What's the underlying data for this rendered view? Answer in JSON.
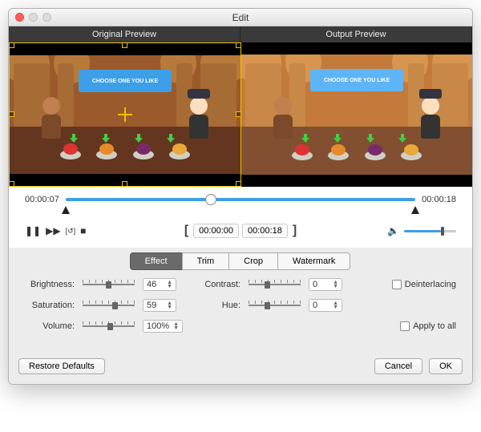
{
  "window": {
    "title": "Edit"
  },
  "preview": {
    "original_label": "Original Preview",
    "output_label": "Output Preview",
    "banner_text": "CHOOSE ONE YOU LIKE"
  },
  "timeline": {
    "current": "00:00:07",
    "end": "00:00:18"
  },
  "playback": {
    "pause_glyph": "❚❚",
    "next_glyph": "▶▶",
    "loop_glyph": "[↺]",
    "stop_glyph": "■"
  },
  "range": {
    "open": "[",
    "start": "00:00:00",
    "end": "00:00:18",
    "close": "]"
  },
  "volume": {
    "icon": "🔉"
  },
  "tabs": {
    "t0": "Effect",
    "t1": "Trim",
    "t2": "Crop",
    "t3": "Watermark"
  },
  "effects": {
    "brightness_label": "Brightness:",
    "brightness_value": "46",
    "contrast_label": "Contrast:",
    "contrast_value": "0",
    "saturation_label": "Saturation:",
    "saturation_value": "59",
    "hue_label": "Hue:",
    "hue_value": "0",
    "volume_label": "Volume:",
    "volume_value": "100%",
    "deinterlace_label": "Deinterlacing",
    "apply_all_label": "Apply to all"
  },
  "footer": {
    "restore": "Restore Defaults",
    "cancel": "Cancel",
    "ok": "OK"
  }
}
